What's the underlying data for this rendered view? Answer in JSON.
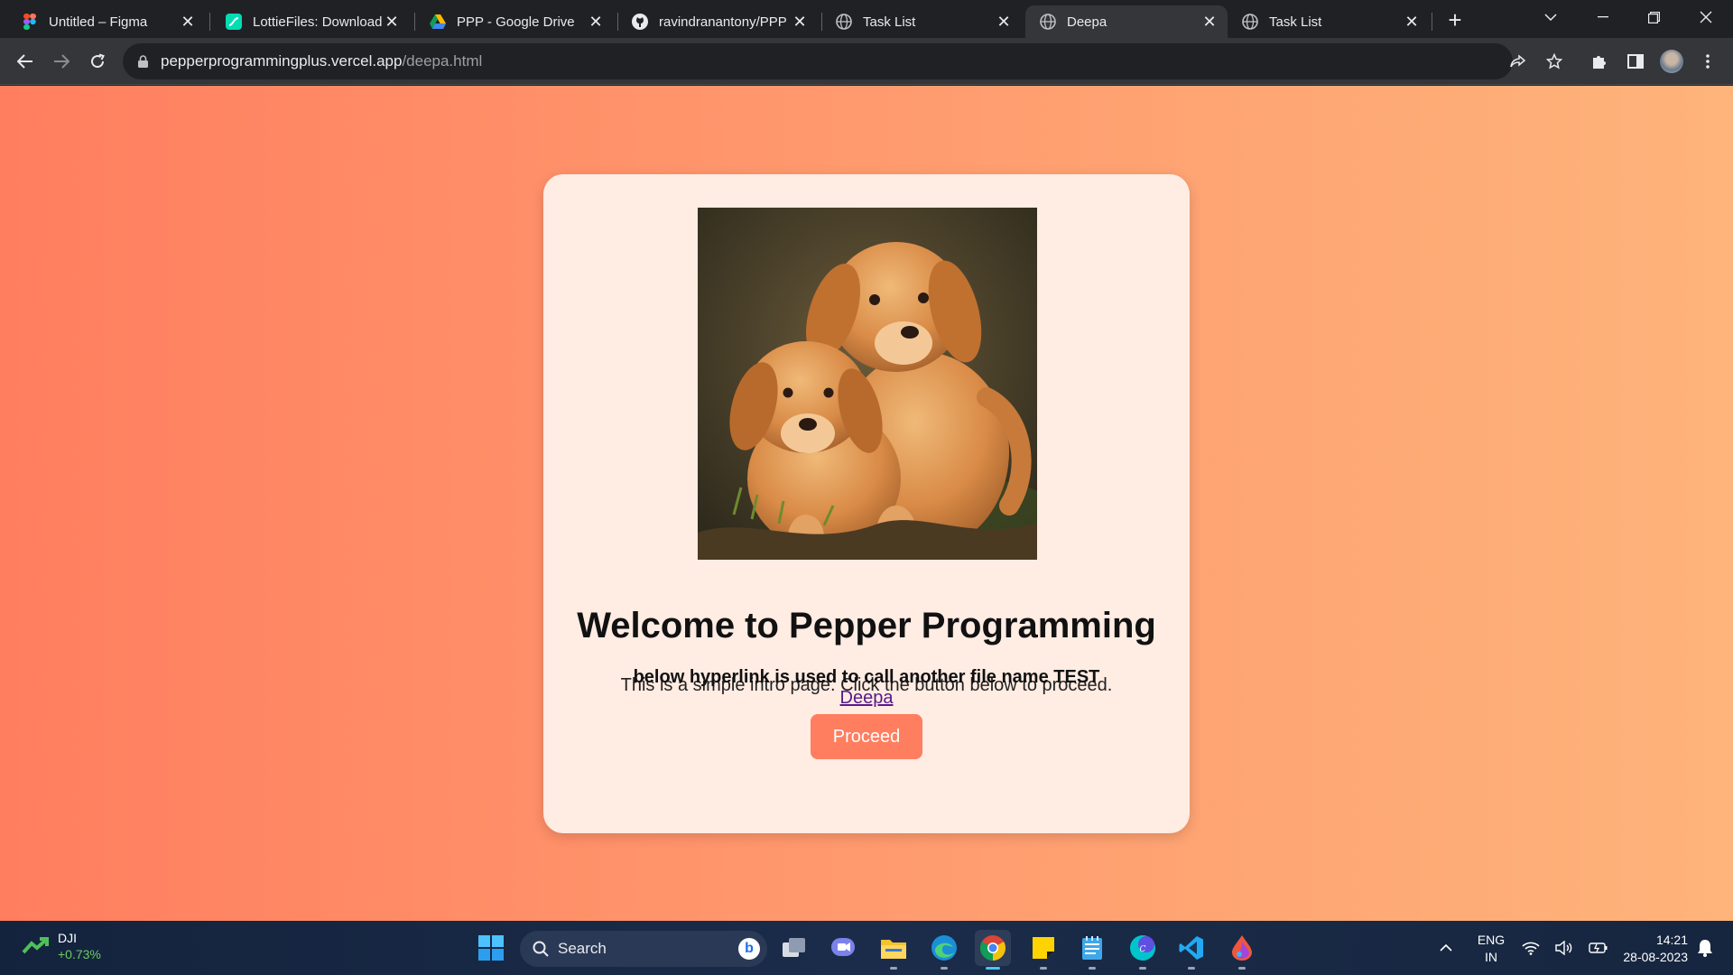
{
  "browser": {
    "tabs": [
      {
        "title": "Untitled – Figma",
        "icon": "figma-icon"
      },
      {
        "title": "LottieFiles: Download",
        "icon": "lottiefiles-icon"
      },
      {
        "title": "PPP - Google Drive",
        "icon": "google-drive-icon"
      },
      {
        "title": "ravindranantony/PPP",
        "icon": "github-icon"
      },
      {
        "title": "Task List",
        "icon": "globe-icon"
      },
      {
        "title": "Deepa",
        "icon": "globe-icon",
        "active": true
      },
      {
        "title": "Task List",
        "icon": "globe-icon"
      }
    ],
    "url": {
      "host": "pepperprogrammingplus.vercel.app",
      "path": "/deepa.html"
    }
  },
  "page": {
    "image_subject": "two golden retriever puppies",
    "heading": "Welcome to Pepper Programming",
    "intro": "This is a simple intro page. Click the button below to proceed.",
    "button_label": "Proceed",
    "note": "below hyperlink is used to call another file name TEST",
    "link_text": "Deepa"
  },
  "taskbar": {
    "ticker": {
      "name": "DJI",
      "change": "+0.73%"
    },
    "search_label": "Search",
    "language": {
      "line1": "ENG",
      "line2": "IN"
    },
    "clock": {
      "time": "14:21",
      "date": "28-08-2023"
    },
    "pinned": [
      "task-view-icon",
      "teams-chat-icon",
      "file-explorer-icon",
      "edge-icon",
      "chrome-icon",
      "sticky-notes-icon",
      "notepad-icon",
      "canva-icon",
      "vscode-icon",
      "paint-drop-icon"
    ]
  },
  "colors": {
    "page_gradient_start": "#ff7e5f",
    "page_gradient_end": "#feb47b",
    "button": "#ff7e5f",
    "card": "#ffece3"
  }
}
